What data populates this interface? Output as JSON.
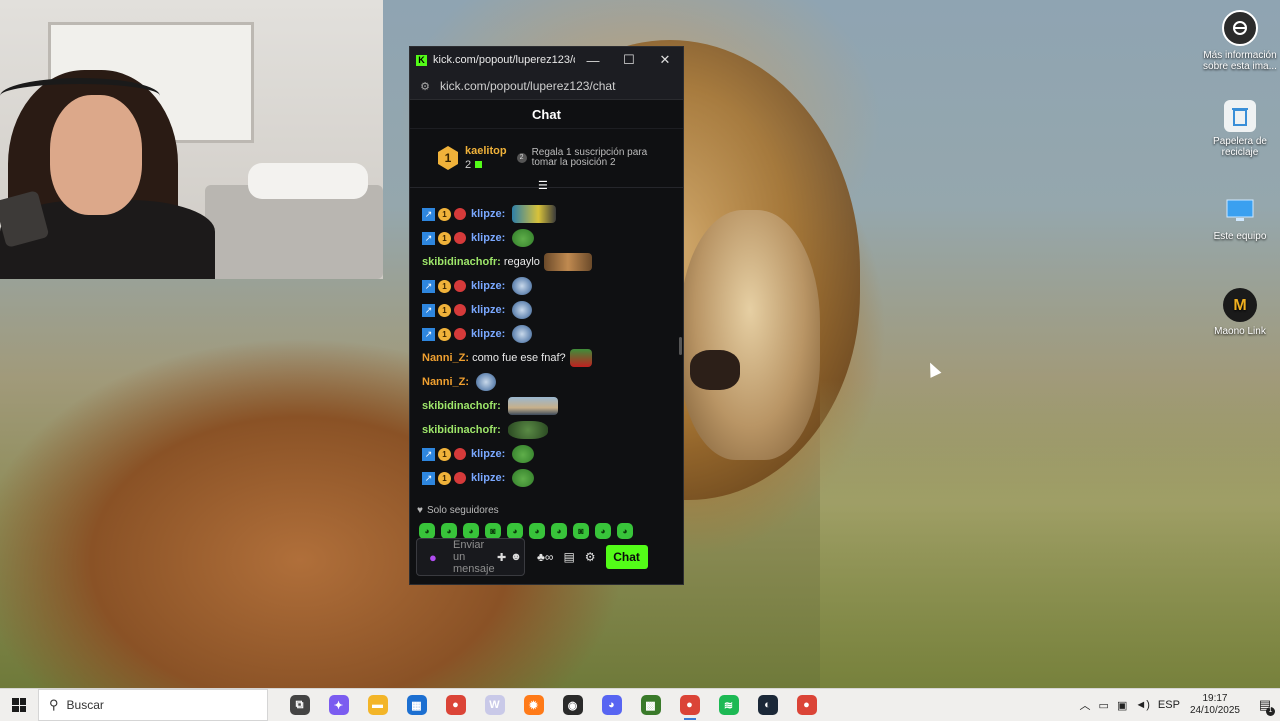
{
  "desktop": {
    "icons": [
      {
        "label": "Más información sobre esta ima...",
        "icon": "camera-icon"
      },
      {
        "label": "Papelera de reciclaje",
        "icon": "recycle-bin-icon"
      },
      {
        "label": "Este equipo",
        "icon": "monitor-icon"
      },
      {
        "label": "Maono Link",
        "icon": "maono-link-icon"
      }
    ]
  },
  "browser": {
    "title": "kick.com/popout/luperez123/c...",
    "url": "kick.com/popout/luperez123/chat",
    "controls": {
      "minimize": "—",
      "maximize": "☐",
      "close": "✕"
    }
  },
  "chat": {
    "header": "Chat",
    "pinned": {
      "rank": "1",
      "username": "kaelitop",
      "count": "2",
      "promo_number": "2",
      "promo_text": "Regala 1 suscripción para tomar la posición 2"
    },
    "messages": [
      {
        "user": "klipze:",
        "text": "",
        "badges": true,
        "color": "blue",
        "emote": "e-wide"
      },
      {
        "user": "klipze:",
        "text": "",
        "badges": true,
        "color": "blue",
        "emote": "e-pepe"
      },
      {
        "user": "skibidinachofr:",
        "text": "regaylo",
        "badges": false,
        "color": "green",
        "emote": "e-duo"
      },
      {
        "user": "klipze:",
        "text": "",
        "badges": true,
        "color": "blue",
        "emote": "e-blue"
      },
      {
        "user": "klipze:",
        "text": "",
        "badges": true,
        "color": "blue",
        "emote": "e-blue"
      },
      {
        "user": "klipze:",
        "text": "",
        "badges": true,
        "color": "blue",
        "emote": "e-blue"
      },
      {
        "user": "Nanni_Z:",
        "text": "como fue ese fnaf?",
        "badges": false,
        "color": "orange",
        "emote": "e-red"
      },
      {
        "user": "Nanni_Z:",
        "text": "",
        "badges": false,
        "color": "orange",
        "emote": "e-blue"
      },
      {
        "user": "skibidinachofr:",
        "text": "",
        "badges": false,
        "color": "green",
        "emote": "e-car"
      },
      {
        "user": "skibidinachofr:",
        "text": "",
        "badges": false,
        "color": "green",
        "emote": "e-frog2"
      },
      {
        "user": "klipze:",
        "text": "",
        "badges": true,
        "color": "blue",
        "emote": "e-pepe"
      },
      {
        "user": "klipze:",
        "text": "",
        "badges": true,
        "color": "blue",
        "emote": "e-pepe"
      }
    ],
    "followers_only": "Solo seguidores",
    "input_placeholder": "Enviar un mensaje",
    "send_button": "Chat"
  },
  "taskbar": {
    "search_placeholder": "Buscar",
    "apps": [
      {
        "name": "task-view-icon",
        "color": "#444444",
        "glyph": "⧉"
      },
      {
        "name": "copilot-icon",
        "color": "#7b5cf0",
        "glyph": "✦"
      },
      {
        "name": "file-explorer-icon",
        "color": "#f3b528",
        "glyph": "▬"
      },
      {
        "name": "microsoft-store-icon",
        "color": "#1c6fd1",
        "glyph": "▦"
      },
      {
        "name": "chrome-icon",
        "color": "#db4437",
        "glyph": "●"
      },
      {
        "name": "word-icon",
        "color": "#c9c9e8",
        "glyph": "W"
      },
      {
        "name": "sun-app-icon",
        "color": "#ff7a18",
        "glyph": "✹"
      },
      {
        "name": "obs-icon",
        "color": "#2a2a2a",
        "glyph": "◉"
      },
      {
        "name": "discord-icon",
        "color": "#5865f2",
        "glyph": "◕"
      },
      {
        "name": "minecraft-icon",
        "color": "#3a7a2a",
        "glyph": "▩"
      },
      {
        "name": "chrome-profile-icon",
        "color": "#db4437",
        "glyph": "●"
      },
      {
        "name": "spotify-icon",
        "color": "#1db954",
        "glyph": "≋"
      },
      {
        "name": "steam-icon",
        "color": "#1b2838",
        "glyph": "◐"
      },
      {
        "name": "chrome-alt-icon",
        "color": "#db4437",
        "glyph": "●"
      }
    ],
    "language": "ESP",
    "time": "19:17",
    "date": "24/10/2025",
    "notifications": "1"
  }
}
